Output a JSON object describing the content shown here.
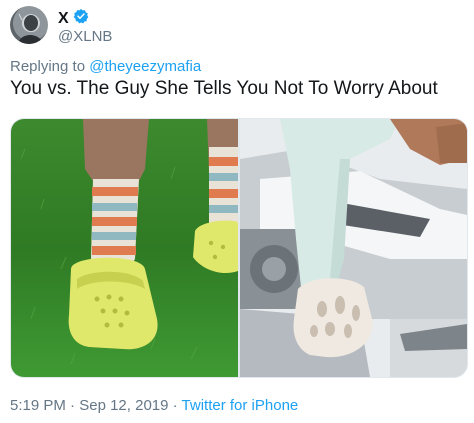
{
  "user": {
    "display_name": "X",
    "handle": "@XLNB",
    "verified_icon": "verified-badge-icon",
    "verified_color": "#1da1f2"
  },
  "reply": {
    "prefix": "Replying to ",
    "mention": "@theyeezymafia"
  },
  "tweet": {
    "text": "You vs. The Guy She Tells You Not To Worry About"
  },
  "media": {
    "left_image": "yellow-crocs-photo",
    "right_image": "yeezy-foam-runner-photo"
  },
  "meta": {
    "time": "5:19 PM",
    "separator": " · ",
    "date": "Sep 12, 2019",
    "source": "Twitter for iPhone"
  },
  "colors": {
    "link": "#1da1f2",
    "secondary_text": "#657786",
    "primary_text": "#14171a"
  }
}
